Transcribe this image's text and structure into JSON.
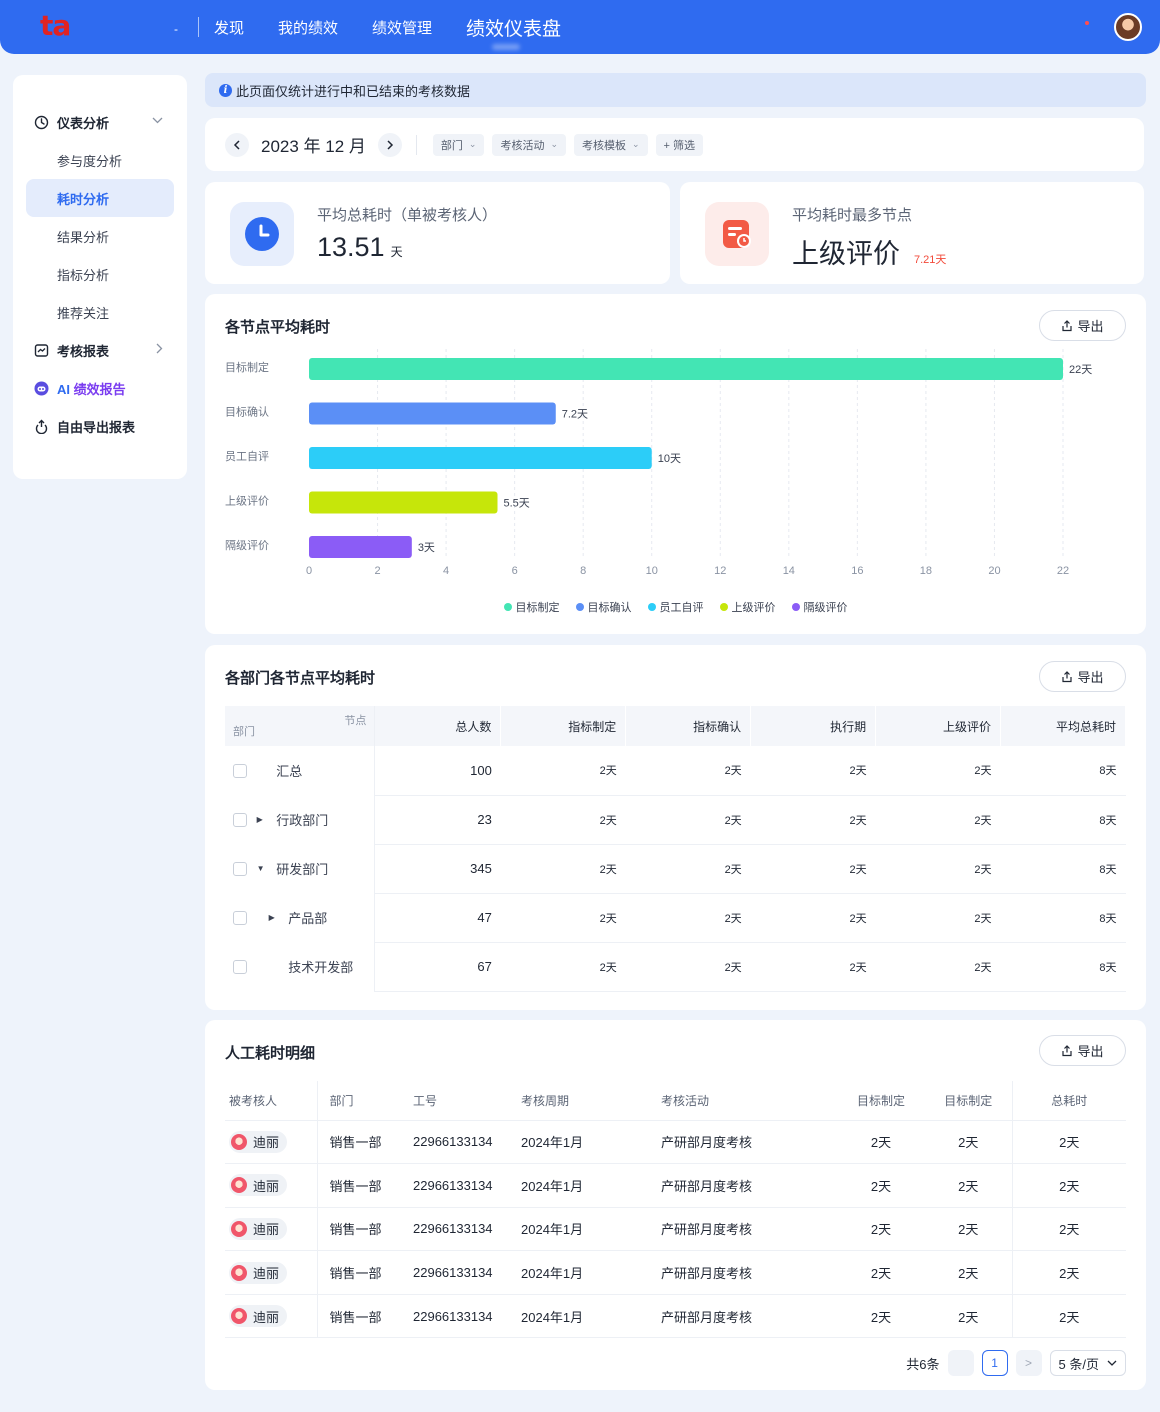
{
  "app": {
    "logo": "ta",
    "nav_dash": "-",
    "nav": [
      "发现",
      "我的绩效",
      "绩效管理",
      "绩效仪表盘"
    ]
  },
  "sidebar": {
    "group_dashboard": "仪表分析",
    "items": [
      "参与度分析",
      "耗时分析",
      "结果分析",
      "指标分析",
      "推荐关注"
    ],
    "group_report": "考核报表",
    "ai_prefix": "AI",
    "ai_label": "绩效报告",
    "export_report": "自由导出报表"
  },
  "notice": "此页面仅统计进行中和已结束的考核数据",
  "filter": {
    "month": "2023 年 12 月",
    "chips": [
      "部门",
      "考核活动",
      "考核模板"
    ],
    "filter_label": "+ 筛选"
  },
  "stats": {
    "avg_total_title": "平均总耗时（单被考核人）",
    "avg_total_value": "13.51",
    "avg_total_unit": "天",
    "max_node_title": "平均耗时最多节点",
    "max_node_value": "上级评价",
    "max_node_badge": "7.21天"
  },
  "node_panel": {
    "title": "各节点平均耗时",
    "export": "导出"
  },
  "chart_data": {
    "type": "bar",
    "orientation": "horizontal",
    "categories": [
      "目标制定",
      "目标确认",
      "员工自评",
      "上级评价",
      "隔级评价"
    ],
    "values": [
      22,
      7.2,
      10,
      5.5,
      3
    ],
    "value_labels": [
      "22天",
      "7.2天",
      "10天",
      "5.5天",
      "3天"
    ],
    "colors": [
      "#43e5b4",
      "#5b8ff6",
      "#2ccdf8",
      "#c6e60a",
      "#8b5cf6"
    ],
    "xlim": [
      0,
      22
    ],
    "xticks": [
      0,
      2,
      4,
      6,
      8,
      10,
      12,
      14,
      16,
      18,
      20,
      22
    ],
    "grid": "vertical dashed",
    "legend": "bottom-center",
    "legend_entries": [
      "目标制定",
      "目标确认",
      "员工自评",
      "上级评价",
      "隔级评价"
    ]
  },
  "dept_panel": {
    "title": "各部门各节点平均耗时",
    "export": "导出",
    "corner_top": "节点",
    "corner_bottom": "部门",
    "headers": [
      "总人数",
      "指标制定",
      "指标确认",
      "执行期",
      "上级评价",
      "平均总耗时"
    ],
    "rows": [
      {
        "name": "汇总",
        "caret": "",
        "values": [
          "100",
          "2天",
          "2天",
          "2天",
          "2天",
          "8天"
        ]
      },
      {
        "name": "行政部门",
        "caret": "▶",
        "values": [
          "23",
          "2天",
          "2天",
          "2天",
          "2天",
          "8天"
        ]
      },
      {
        "name": "研发部门",
        "caret": "▼",
        "values": [
          "345",
          "2天",
          "2天",
          "2天",
          "2天",
          "8天"
        ]
      },
      {
        "name": "产品部",
        "caret": "▶",
        "values": [
          "47",
          "2天",
          "2天",
          "2天",
          "2天",
          "8天"
        ]
      },
      {
        "name": "技术开发部",
        "caret": "",
        "values": [
          "67",
          "2天",
          "2天",
          "2天",
          "2天",
          "8天"
        ]
      }
    ]
  },
  "detail_panel": {
    "title": "人工耗时明细",
    "export": "导出",
    "headers": [
      "被考核人",
      "部门",
      "工号",
      "考核周期",
      "考核活动",
      "目标制定",
      "目标制定",
      "总耗时"
    ],
    "rows": [
      [
        "迪丽",
        "销售一部",
        "22966133134",
        "2024年1月",
        "产研部月度考核",
        "2天",
        "2天",
        "2天"
      ],
      [
        "迪丽",
        "销售一部",
        "22966133134",
        "2024年1月",
        "产研部月度考核",
        "2天",
        "2天",
        "2天"
      ],
      [
        "迪丽",
        "销售一部",
        "22966133134",
        "2024年1月",
        "产研部月度考核",
        "2天",
        "2天",
        "2天"
      ],
      [
        "迪丽",
        "销售一部",
        "22966133134",
        "2024年1月",
        "产研部月度考核",
        "2天",
        "2天",
        "2天"
      ],
      [
        "迪丽",
        "销售一部",
        "22966133134",
        "2024年1月",
        "产研部月度考核",
        "2天",
        "2天",
        "2天"
      ]
    ],
    "pager": {
      "total": "共6条",
      "prev": "<",
      "current": "1",
      "next": ">",
      "page_size": "5 条/页"
    }
  }
}
